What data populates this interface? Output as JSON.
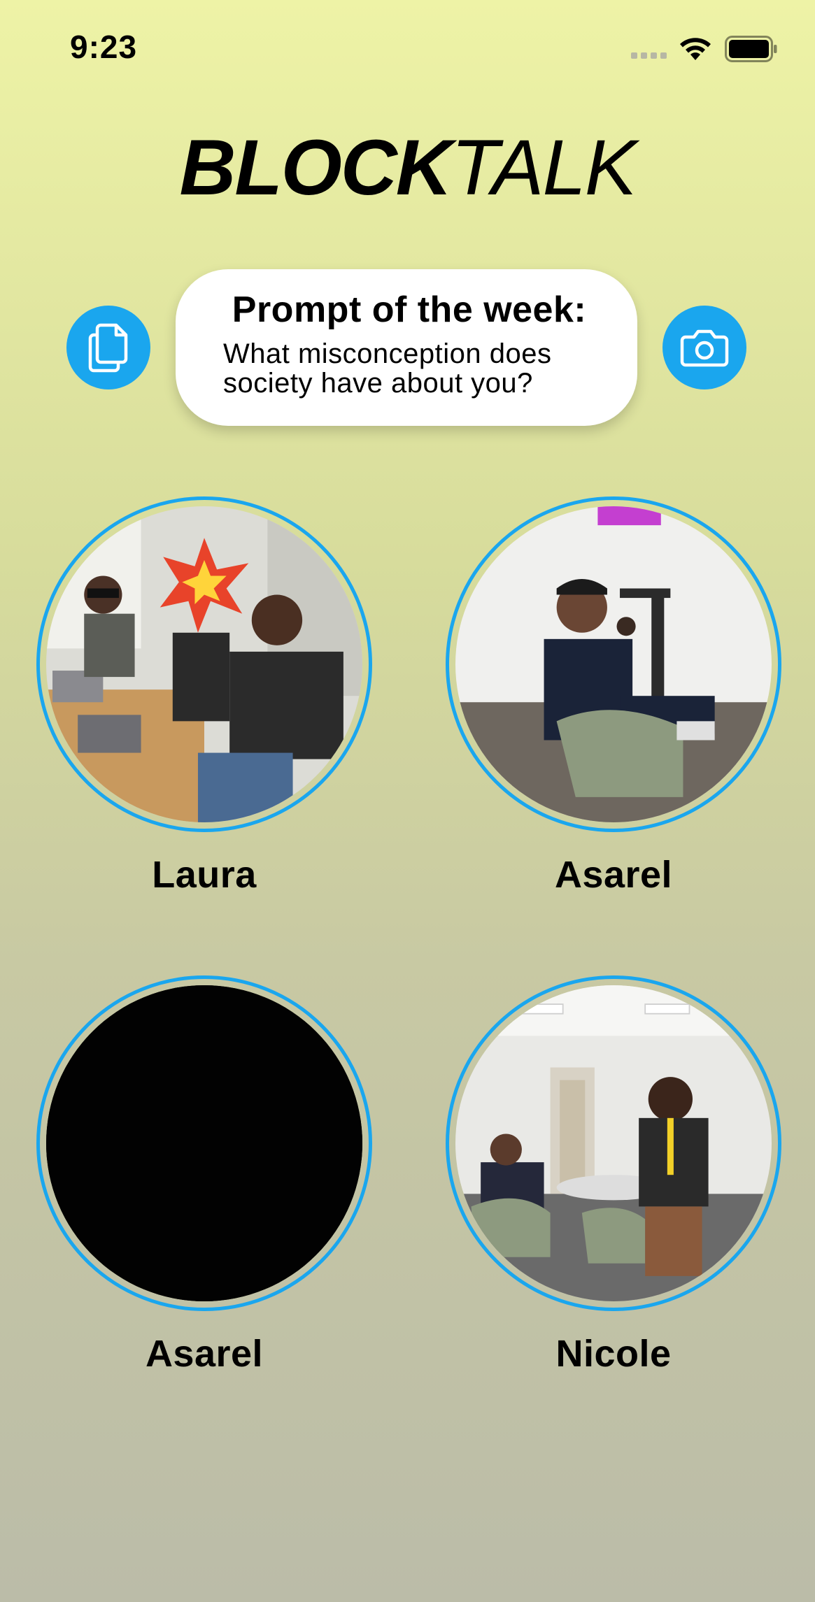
{
  "status_bar": {
    "time": "9:23"
  },
  "app": {
    "logo_bold": "BLOCK",
    "logo_light": "TALK"
  },
  "prompt": {
    "title": "Prompt of the week:",
    "text": "What misconception does society have about you?"
  },
  "actions": {
    "copy_icon": "copy-icon",
    "camera_icon": "camera-icon"
  },
  "friends": [
    {
      "name": "Laura",
      "photo": "group-office-photo"
    },
    {
      "name": "Asarel",
      "photo": "seated-man-photo"
    },
    {
      "name": "Asarel",
      "photo": "black-photo"
    },
    {
      "name": "Nicole",
      "photo": "standing-woman-photo"
    }
  ],
  "colors": {
    "accent": "#1aa6ee",
    "background_top": "#eef3a6",
    "background_bottom": "#bbbca8"
  }
}
